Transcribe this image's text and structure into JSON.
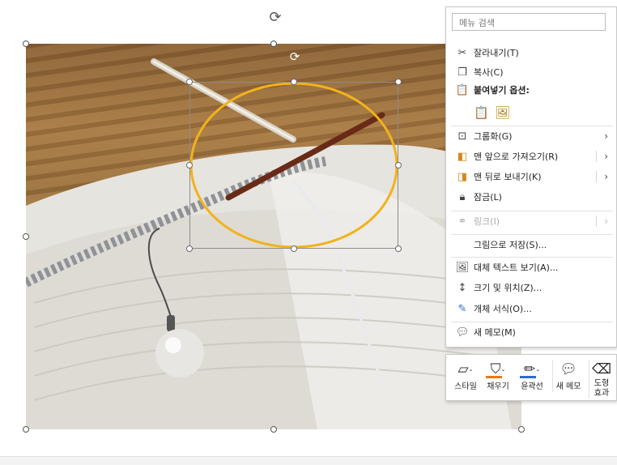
{
  "menu": {
    "search_placeholder": "메뉴 검색",
    "items": {
      "cut": "잘라내기(T)",
      "copy": "복사(C)",
      "paste_options": "붙여넣기 옵션:",
      "group": "그룹화(G)",
      "bring_front": "맨 앞으로 가져오기(R)",
      "send_back": "맨 뒤로 보내기(K)",
      "lock": "잠금(L)",
      "link": "링크(I)",
      "save_as_picture": "그림으로 저장(S)...",
      "alt_text": "대체 텍스트 보기(A)...",
      "size_position": "크기 및 위치(Z)...",
      "format_object": "개체 서식(O)...",
      "new_note": "새 메모(M)"
    }
  },
  "toolbar": {
    "style": "스타일",
    "fill": "채우기",
    "outline": "윤곽선",
    "new_note": "새 메모",
    "shape_effects_line1": "도형",
    "shape_effects_line2": "효과"
  },
  "colors": {
    "fill_accent": "#e8781a",
    "outline_accent": "#2f6ccf",
    "ellipse_stroke": "#f2b21a"
  },
  "icons": {
    "cut": "scissors-icon",
    "copy": "copy-icon",
    "paste": "clipboard-icon",
    "group": "group-icon",
    "lock": "lock-icon",
    "link": "link-icon",
    "rotate": "rotate-icon"
  }
}
